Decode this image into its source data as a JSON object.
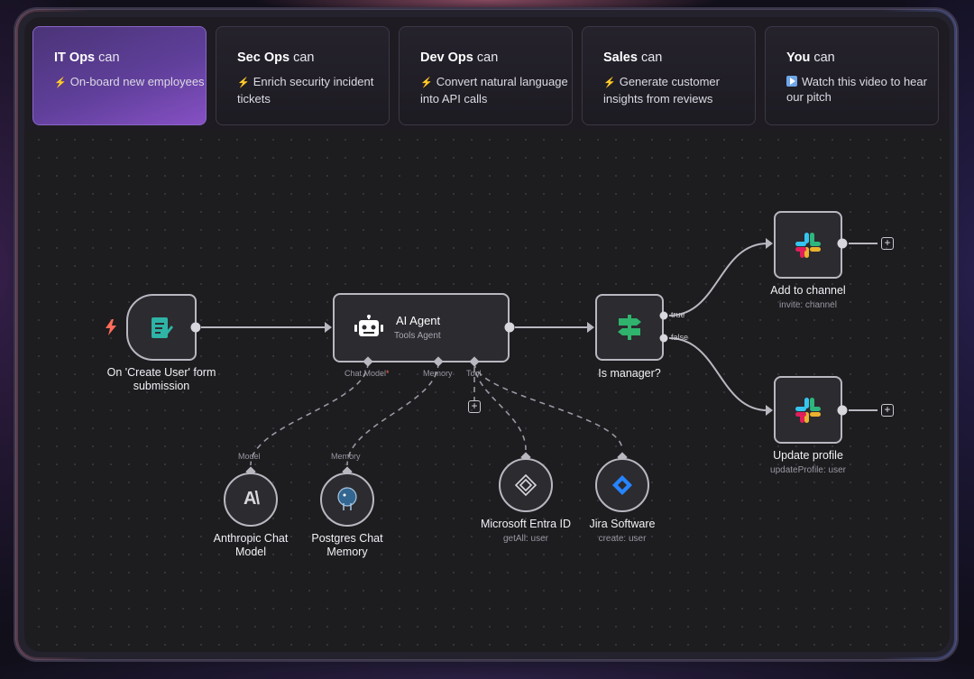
{
  "tabs": [
    {
      "team": "IT Ops",
      "can": "can",
      "icon": "bolt-icon",
      "desc": "On-board new employees",
      "active": true
    },
    {
      "team": "Sec Ops",
      "can": "can",
      "icon": "bolt-icon",
      "desc": "Enrich security incident tickets",
      "active": false
    },
    {
      "team": "Dev Ops",
      "can": "can",
      "icon": "bolt-icon",
      "desc": "Convert natural language into API calls",
      "active": false
    },
    {
      "team": "Sales",
      "can": "can",
      "icon": "bolt-icon",
      "desc": "Generate customer insights from reviews",
      "active": false
    },
    {
      "team": "You",
      "can": "can",
      "icon": "play-icon",
      "desc": "Watch this video to hear our pitch",
      "active": false
    }
  ],
  "workflow": {
    "trigger": {
      "label": "On 'Create User' form submission",
      "icon": "form-icon"
    },
    "agent": {
      "title": "AI Agent",
      "subtitle": "Tools Agent",
      "icon": "robot-icon",
      "ports": {
        "chat_model": "Chat Model",
        "chat_model_required": "*",
        "memory": "Memory",
        "tool": "Tool"
      }
    },
    "switch": {
      "label": "Is manager?",
      "icon": "signpost-icon",
      "true_label": "true",
      "false_label": "false"
    },
    "add_channel": {
      "label": "Add to channel",
      "sub": "invite: channel",
      "icon": "slack-icon"
    },
    "update_profile": {
      "label": "Update profile",
      "sub": "updateProfile: user",
      "icon": "slack-icon"
    },
    "anthropic": {
      "port": "Model",
      "label_line1": "Anthropic Chat",
      "label_line2": "Model",
      "icon": "anthropic-icon"
    },
    "postgres": {
      "port": "Memory",
      "label_line1": "Postgres Chat",
      "label_line2": "Memory",
      "icon": "postgres-icon"
    },
    "entra": {
      "label": "Microsoft Entra ID",
      "sub": "getAll: user",
      "icon": "entra-icon"
    },
    "jira": {
      "label": "Jira Software",
      "sub": "create: user",
      "icon": "jira-icon"
    }
  },
  "colors": {
    "active_tab": "#5f3f9a",
    "node_border": "#b9b8c0",
    "trigger_bolt": "#ff6d5a",
    "switch_green": "#2fb36d",
    "jira_blue": "#2684ff"
  }
}
